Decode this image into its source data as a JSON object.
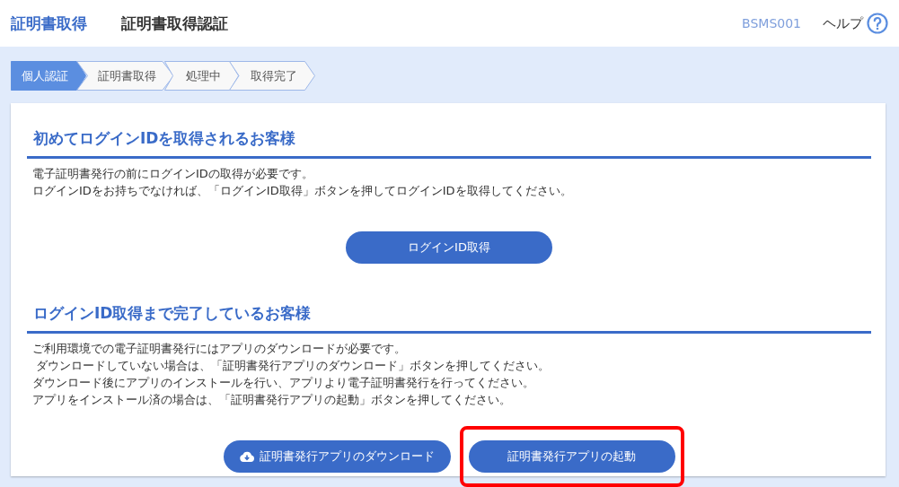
{
  "header": {
    "app_title": "証明書取得",
    "page_title": "証明書取得認証",
    "screen_id": "BSMS001",
    "help": "ヘルプ"
  },
  "steps": [
    {
      "label": "個人認証",
      "selected": true
    },
    {
      "label": "証明書取得",
      "selected": false
    },
    {
      "label": "処理中",
      "selected": false
    },
    {
      "label": "取得完了",
      "selected": false
    }
  ],
  "sections": [
    {
      "heading": "初めてログインIDを取得されるお客様",
      "lines": [
        "電子証明書発行の前にログインIDの取得が必要です。",
        "ログインIDをお持ちでなければ、「ログインID取得」ボタンを押してログインIDを取得してください。"
      ],
      "buttons": [
        {
          "label": "ログインID取得",
          "kind": "plain",
          "highlighted": false
        }
      ]
    },
    {
      "heading": "ログインID取得まで完了しているお客様",
      "lines": [
        "ご利用環境での電子証明書発行にはアプリのダウンロードが必要です。",
        " ダウンロードしていない場合は、「証明書発行アプリのダウンロード」ボタンを押してください。",
        "ダウンロード後にアプリのインストールを行い、アプリより電子証明書発行を行ってください。",
        "アプリをインストール済の場合は、「証明書発行アプリの起動」ボタンを押してください。"
      ],
      "buttons": [
        {
          "label": "証明書発行アプリのダウンロード",
          "kind": "download",
          "highlighted": false
        },
        {
          "label": "証明書発行アプリの起動",
          "kind": "plain",
          "highlighted": true
        }
      ]
    }
  ]
}
